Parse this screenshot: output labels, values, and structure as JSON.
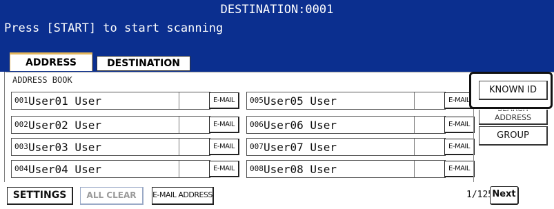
{
  "header": {
    "destination_line": "DESTINATION:0001",
    "instruction": "Press [START] to start scanning"
  },
  "tabs": [
    {
      "label": "ADDRESS",
      "active": true
    },
    {
      "label": "DESTINATION",
      "active": false
    }
  ],
  "address_book": {
    "label": "ADDRESS BOOK",
    "entries": [
      {
        "num": "001",
        "name": "User01 User",
        "email_label": "E-MAIL"
      },
      {
        "num": "002",
        "name": "User02 User",
        "email_label": "E-MAIL"
      },
      {
        "num": "003",
        "name": "User03 User",
        "email_label": "E-MAIL"
      },
      {
        "num": "004",
        "name": "User04 User",
        "email_label": "E-MAIL"
      },
      {
        "num": "005",
        "name": "User05 User",
        "email_label": "E-MAIL"
      },
      {
        "num": "006",
        "name": "User06 User",
        "email_label": "E-MAIL"
      },
      {
        "num": "007",
        "name": "User07 User",
        "email_label": "E-MAIL"
      },
      {
        "num": "008",
        "name": "User08 User",
        "email_label": "E-MAIL"
      }
    ]
  },
  "side_buttons": {
    "known_id": "KNOWN ID",
    "search_address": "SEARCH ADDRESS",
    "group": "GROUP"
  },
  "footer": {
    "settings": "SETTINGS",
    "all_clear": "ALL CLEAR",
    "email_address": "E-MAIL ADDRESS",
    "page_current": "1",
    "page_total": "125",
    "page_indicator": "1/125",
    "next": "Next"
  },
  "colors": {
    "header_bg": "#0b2f8f",
    "active_tab_accent": "#e2b55b",
    "disabled_text": "#9a9a9a"
  }
}
